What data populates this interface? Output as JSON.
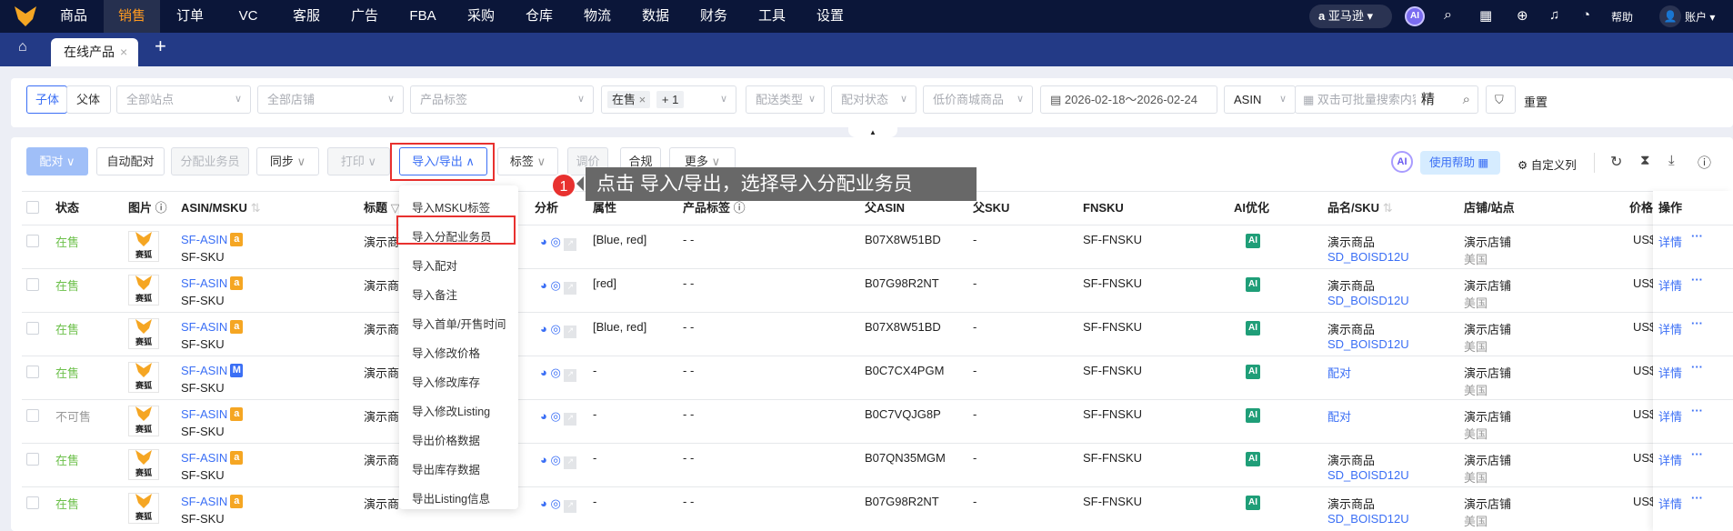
{
  "nav": {
    "items": [
      "商品",
      "销售",
      "订单",
      "VC",
      "客服",
      "广告",
      "FBA",
      "采购",
      "仓库",
      "物流",
      "数据",
      "财务",
      "工具",
      "设置"
    ],
    "active": "销售",
    "marketplace": "亚马逊",
    "ai": "AI",
    "help": "帮助",
    "account": "账户"
  },
  "tabs": {
    "active": "在线产品",
    "add": "+"
  },
  "filters": {
    "child": "子体",
    "parent": "父体",
    "site": "全部站点",
    "shop": "全部店铺",
    "tag": "产品标签",
    "status_tag": "在售",
    "status_more": "+ 1",
    "delivery": "配送类型",
    "pair_status": "配对状态",
    "low_price": "低价商城商品",
    "date_range": "2026-02-18～2026-02-24",
    "search_type": "ASIN",
    "search_placeholder": "双击可批量搜索内容",
    "exact": "精",
    "reset": "重置"
  },
  "toolbar": {
    "pair": "配对",
    "auto_pair": "自动配对",
    "assign": "分配业务员",
    "sync": "同步",
    "print": "打印",
    "import_export": "导入/导出",
    "tags": "标签",
    "price": "调价",
    "compliance": "合规",
    "more": "更多",
    "ai": "AI",
    "usage_help": "使用帮助",
    "custom_cols": "自定义列"
  },
  "table": {
    "headers": {
      "status": "状态",
      "image": "图片",
      "asin": "ASIN/MSKU",
      "title": "标题",
      "analysis": "分析",
      "attr": "属性",
      "ptag": "产品标签",
      "parent_asin": "父ASIN",
      "parent_sku": "父SKU",
      "fnsku": "FNSKU",
      "ai": "AI优化",
      "name": "品名/SKU",
      "shop": "店铺/站点",
      "price": "价格",
      "ops": "操作"
    },
    "rows": [
      {
        "status": "在售",
        "avail": true,
        "asin": "SF-ASIN",
        "badge": "a",
        "sku": "SF-SKU",
        "title": "演示商品",
        "attr": "[Blue, red]",
        "ptag": "- -",
        "parent_asin": "B07X8W51BD",
        "parent_sku": "-",
        "fnsku": "SF-FNSKU",
        "name": "演示商品",
        "name_sku": "SD_BOISD12U",
        "shop": "演示店铺",
        "site": "美国",
        "price": "US$",
        "detail": "详情"
      },
      {
        "status": "在售",
        "avail": true,
        "asin": "SF-ASIN",
        "badge": "a",
        "sku": "SF-SKU",
        "title": "演示商品",
        "attr": "[red]",
        "ptag": "- -",
        "parent_asin": "B07G98R2NT",
        "parent_sku": "-",
        "fnsku": "SF-FNSKU",
        "name": "演示商品",
        "name_sku": "SD_BOISD12U",
        "shop": "演示店铺",
        "site": "美国",
        "price": "US$",
        "detail": "详情"
      },
      {
        "status": "在售",
        "avail": true,
        "asin": "SF-ASIN",
        "badge": "a",
        "sku": "SF-SKU",
        "title": "演示商品",
        "attr": "[Blue, red]",
        "ptag": "- -",
        "parent_asin": "B07X8W51BD",
        "parent_sku": "-",
        "fnsku": "SF-FNSKU",
        "name": "演示商品",
        "name_sku": "SD_BOISD12U",
        "shop": "演示店铺",
        "site": "美国",
        "price": "US$",
        "detail": "详情"
      },
      {
        "status": "在售",
        "avail": true,
        "asin": "SF-ASIN",
        "badge": "M",
        "sku": "SF-SKU",
        "title": "演示商品",
        "attr": "-",
        "ptag": "- -",
        "parent_asin": "B0C7CX4PGM",
        "parent_sku": "-",
        "fnsku": "SF-FNSKU",
        "name": "配对",
        "name_sku": "",
        "shop": "演示店铺",
        "site": "美国",
        "price": "US$",
        "detail": "详情"
      },
      {
        "status": "不可售",
        "avail": false,
        "asin": "SF-ASIN",
        "badge": "a",
        "sku": "SF-SKU",
        "title": "演示商品",
        "attr": "-",
        "ptag": "- -",
        "parent_asin": "B0C7VQJG8P",
        "parent_sku": "-",
        "fnsku": "SF-FNSKU",
        "name": "配对",
        "name_sku": "",
        "shop": "演示店铺",
        "site": "美国",
        "price": "US$",
        "detail": "详情"
      },
      {
        "status": "在售",
        "avail": true,
        "asin": "SF-ASIN",
        "badge": "a",
        "sku": "SF-SKU",
        "title": "演示商品",
        "attr": "-",
        "ptag": "- -",
        "parent_asin": "B07QN35MGM",
        "parent_sku": "-",
        "fnsku": "SF-FNSKU",
        "name": "演示商品",
        "name_sku": "SD_BOISD12U",
        "shop": "演示店铺",
        "site": "美国",
        "price": "US$",
        "detail": "详情"
      },
      {
        "status": "在售",
        "avail": true,
        "asin": "SF-ASIN",
        "badge": "a",
        "sku": "SF-SKU",
        "title": "演示商品",
        "attr": "-",
        "ptag": "- -",
        "parent_asin": "B07G98R2NT",
        "parent_sku": "-",
        "fnsku": "SF-FNSKU",
        "name": "演示商品",
        "name_sku": "SD_BOISD12U",
        "shop": "演示店铺",
        "site": "美国",
        "price": "US$",
        "detail": "详情"
      }
    ],
    "logo_text": "赛狐"
  },
  "menu": [
    "导入MSKU标签",
    "导入分配业务员",
    "导入配对",
    "导入备注",
    "导入首单/开售时间",
    "导入修改价格",
    "导入修改库存",
    "导入修改Listing",
    "导出价格数据",
    "导出库存数据",
    "导出Listing信息"
  ],
  "guide": {
    "step": "1",
    "text": "点击 导入/导出，选择导入分配业务员"
  },
  "colors": {
    "nav_bg": "#0b1639",
    "tab_bg": "#233a86",
    "accent": "#3b6ff5",
    "active_nav": "#ff9a1f",
    "highlight": "#e8312f"
  }
}
